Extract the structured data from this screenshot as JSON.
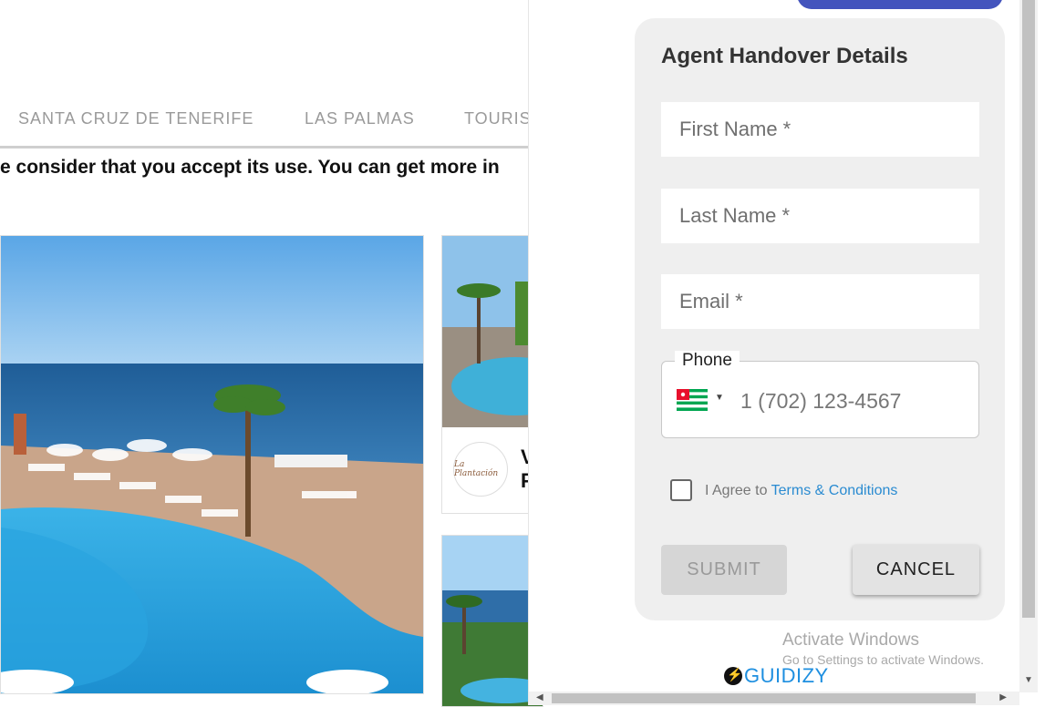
{
  "site": {
    "nav": [
      "SANTA CRUZ DE TENERIFE",
      "LAS PALMAS",
      "TOURIS"
    ],
    "cookie_text": "e consider that you accept its use. You can get more in",
    "card_title_partial": "V\nF",
    "card_logo_text": "La Plantación"
  },
  "form": {
    "title": "Agent Handover Details",
    "first_name_placeholder": "First Name *",
    "last_name_placeholder": "Last Name *",
    "email_placeholder": "Email *",
    "phone_label": "Phone",
    "phone_placeholder": "1 (702) 123-4567",
    "agree_prefix": "I Agree to ",
    "terms_link": "Terms & Conditions",
    "submit_label": "SUBMIT",
    "cancel_label": "CANCEL"
  },
  "watermark": {
    "line1": "Activate Windows",
    "line2": "Go to Settings to activate Windows."
  },
  "brand": {
    "name": "GUIDIZY",
    "color": "#1e8fe0"
  },
  "colors": {
    "accent_pill": "#4354bd",
    "link": "#2a8bd1"
  },
  "icons": [
    "lightning-icon",
    "flag-icon",
    "dropdown-arrow-icon"
  ]
}
